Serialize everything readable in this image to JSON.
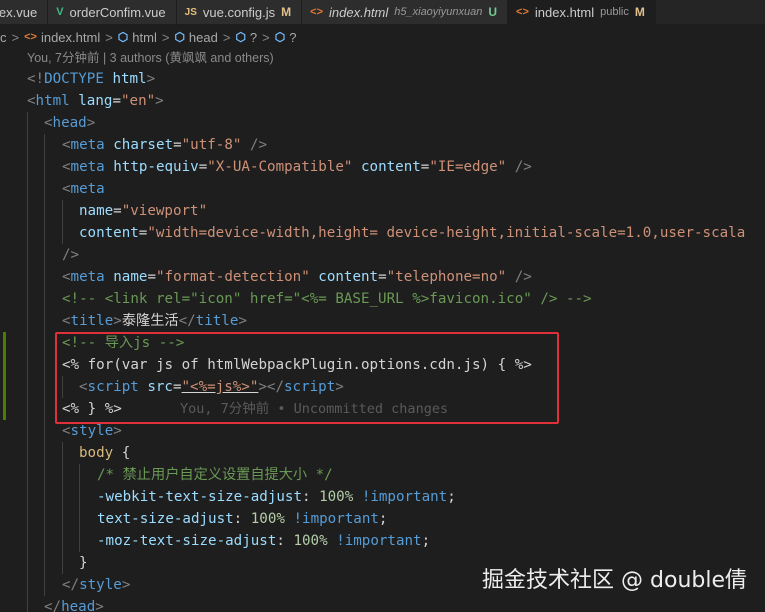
{
  "tabs": [
    {
      "label": "lex.vue",
      "icon": "vue-icon",
      "icon_text": "",
      "desc": "",
      "status": ""
    },
    {
      "label": "orderConfim.vue",
      "icon": "vue-icon",
      "icon_text": "V",
      "desc": "",
      "status": ""
    },
    {
      "label": "vue.config.js",
      "icon": "js-icon",
      "icon_text": "JS",
      "desc": "",
      "status": "M"
    },
    {
      "label": "index.html",
      "icon": "html-icon",
      "icon_text": "<>",
      "desc": "h5_xiaoyiyunxuan",
      "status": "U"
    },
    {
      "label": "index.html",
      "icon": "html-icon",
      "icon_text": "<>",
      "desc": "public",
      "status": "M"
    }
  ],
  "breadcrumb": {
    "items": [
      "c",
      "index.html",
      "html",
      "head",
      "?",
      "?"
    ],
    "separator": ">",
    "html_icon": "<>",
    "cube_icon": "⬡"
  },
  "codelens": "You, 7分钟前 | 3 authors (黄飒飒 and others)",
  "code": {
    "doctype": "<!DOCTYPE html>",
    "html_open_tag": "html",
    "html_lang_attr": "lang",
    "html_lang_val": "\"en\"",
    "head": "head",
    "meta": "meta",
    "charset_attr": "charset",
    "charset_val": "\"utf-8\"",
    "http_equiv_attr": "http-equiv",
    "http_equiv_val": "\"X-UA-Compatible\"",
    "content_attr": "content",
    "content_ie_val": "\"IE=edge\"",
    "name_attr": "name",
    "viewport_val": "\"viewport\"",
    "viewport_content_val": "\"width=device-width,height= device-height,initial-scale=1.0,user-scala",
    "format_detection_val": "\"format-detection\"",
    "telephone_val": "\"telephone=no\"",
    "comment_favicon": "<!-- <link rel=\"icon\" href=\"<%= BASE_URL %>favicon.ico\" /> -->",
    "title_tag": "title",
    "title_text": "泰隆生活",
    "comment_import": "<!-- 导入js -->",
    "for_line": "<% for(var js of htmlWebpackPlugin.options.cdn.js) { %>",
    "script_tag": "script",
    "src_attr": "src",
    "src_val": "\"<%=js%>\"",
    "endfor_line": "<% } %>",
    "blame_text": "You, 7分钟前 • Uncommitted changes",
    "style_tag": "style",
    "body_selector": "body",
    "comment_css": "/* 禁止用户自定义设置自提大小 */",
    "prop_webkit": "-webkit-text-size-adjust",
    "prop_tsa": "text-size-adjust",
    "prop_moz": "-moz-text-size-adjust",
    "val_100": "100%",
    "important": "!important"
  },
  "watermark": "掘金技术社区 @ double倩",
  "colors": {
    "tag": "#569cd6",
    "attr": "#9cdcfe",
    "string": "#ce9178",
    "comment": "#6a9955",
    "number": "#b5cea8",
    "selector": "#d7ba7d",
    "highlight_border": "#e0303a",
    "background": "#1e1e1e"
  }
}
